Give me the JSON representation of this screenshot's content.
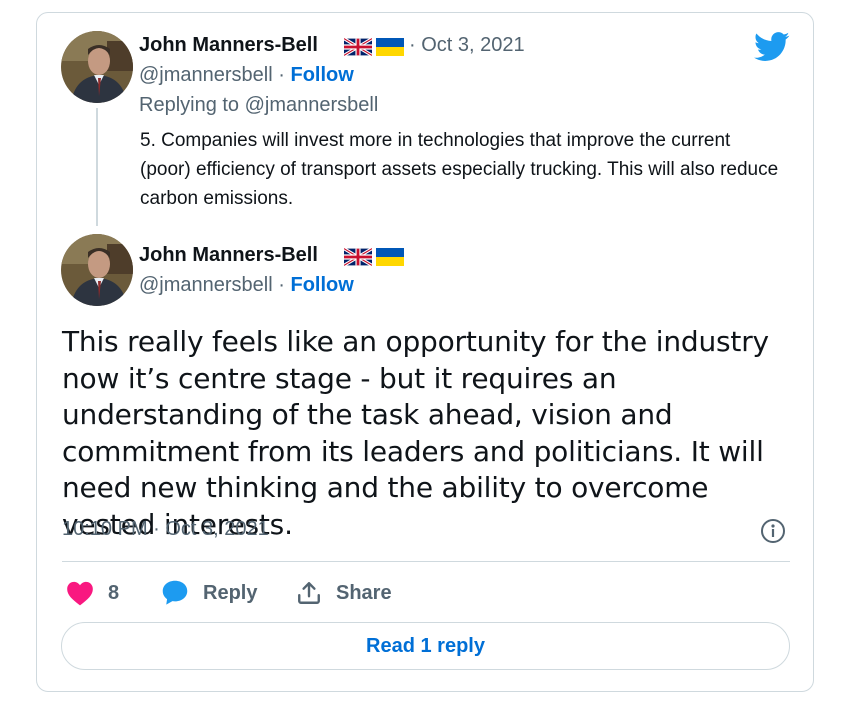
{
  "parent_tweet": {
    "author_name": "John Manners-Bell",
    "handle": "@jmannersbell",
    "separator": "·",
    "follow_label": "Follow",
    "date": "· Oct 3, 2021",
    "replying_to": "Replying to @jmannersbell",
    "text": "5. Companies will invest more in technologies that improve the current (poor) efficiency of transport assets especially trucking. This will also reduce carbon emissions."
  },
  "main_tweet": {
    "author_name": "John Manners-Bell",
    "handle": "@jmannersbell",
    "separator": "·",
    "follow_label": "Follow",
    "text": "This really feels like an opportunity for the industry now it’s centre stage - but it requires an understanding of the task ahead, vision and commitment from its leaders and politicians. It will need new thinking and the ability to overcome vested interests.",
    "timestamp": "10:10 PM · Oct 3, 2021"
  },
  "actions": {
    "like_count": "8",
    "reply_label": "Reply",
    "share_label": "Share"
  },
  "read_replies_label": "Read 1 reply",
  "icons": {
    "brand": "twitter-bird-icon",
    "like": "heart-icon",
    "reply": "speech-bubble-icon",
    "share": "share-upload-icon",
    "info": "info-icon",
    "flags": [
      "uk-flag-icon",
      "ukraine-flag-icon"
    ]
  },
  "colors": {
    "twitter_blue": "#1d9bf0",
    "link_blue": "#006fd6",
    "like_pink": "#f91880",
    "text": "#0f1419",
    "muted": "#536471",
    "border": "#cfd9de"
  }
}
